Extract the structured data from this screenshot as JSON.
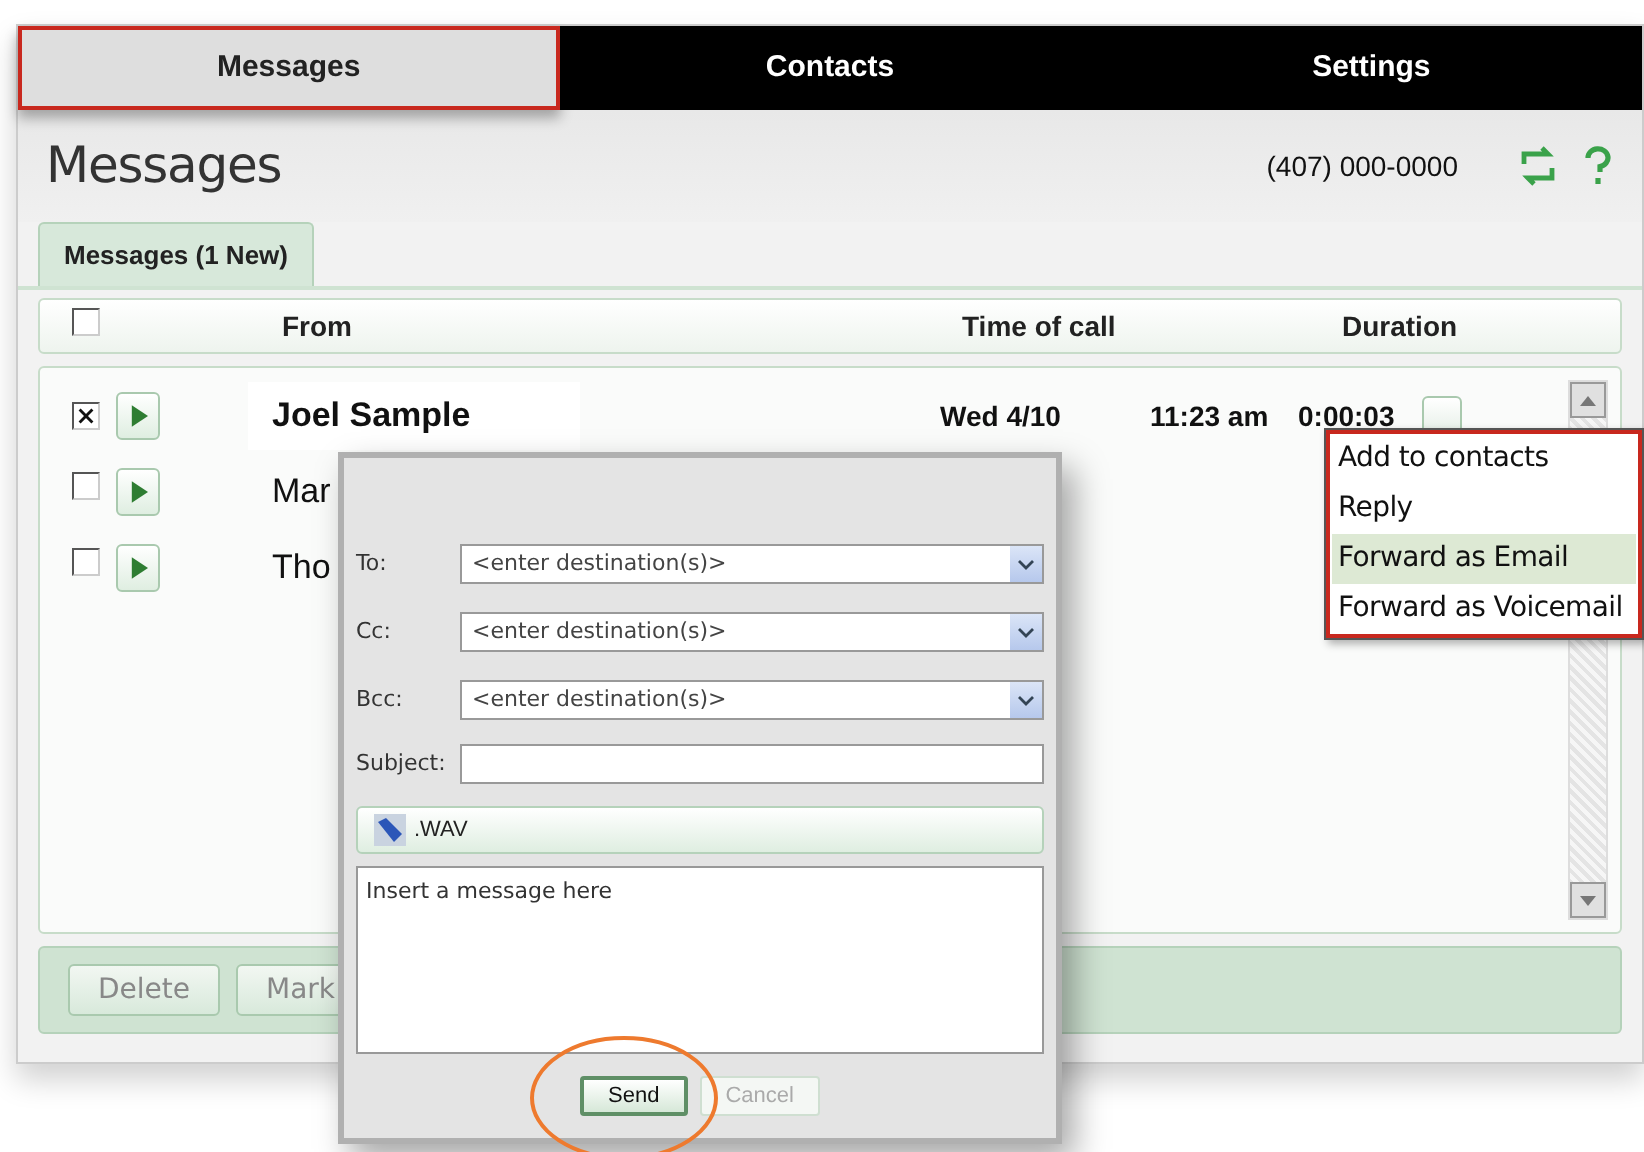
{
  "nav_tabs": [
    {
      "label": "Messages",
      "selected": true
    },
    {
      "label": "Contacts",
      "selected": false
    },
    {
      "label": "Settings",
      "selected": false
    }
  ],
  "page": {
    "title": "Messages",
    "phone": "(407) 000-0000"
  },
  "sub_tabs": [
    {
      "label": "Messages (1 New)",
      "selected": true
    }
  ],
  "table": {
    "select_all_checked": false,
    "columns": [
      "From",
      "Time of call",
      "Duration"
    ],
    "rows": [
      {
        "checked": true,
        "from": "Joel Sample",
        "date": "Wed 4/10",
        "time": "11:23 am",
        "duration": "0:00:03"
      },
      {
        "checked": false,
        "from": "Mar"
      },
      {
        "checked": false,
        "from": "Tho"
      }
    ]
  },
  "context_menu": [
    {
      "label": "Add to contacts",
      "selected": false
    },
    {
      "label": "Reply",
      "selected": false
    },
    {
      "label": "Forward as Email",
      "selected": true
    },
    {
      "label": "Forward as Voicemail",
      "selected": false
    }
  ],
  "bottom_buttons": [
    "Delete",
    "Mark"
  ],
  "dialog": {
    "fields": [
      {
        "kind": "dropdown",
        "label": "To:",
        "placeholder": "<enter destination(s)>"
      },
      {
        "kind": "dropdown",
        "label": "Cc:",
        "placeholder": "<enter destination(s)>"
      },
      {
        "kind": "dropdown",
        "label": "Bcc:",
        "placeholder": "<enter destination(s)>"
      },
      {
        "kind": "text",
        "label": "Subject:"
      }
    ],
    "attachment": ".WAV",
    "message_placeholder": "Insert a message here",
    "buttons": [
      {
        "label": "Send",
        "disabled": false
      },
      {
        "label": "Cancel",
        "disabled": true
      }
    ]
  }
}
